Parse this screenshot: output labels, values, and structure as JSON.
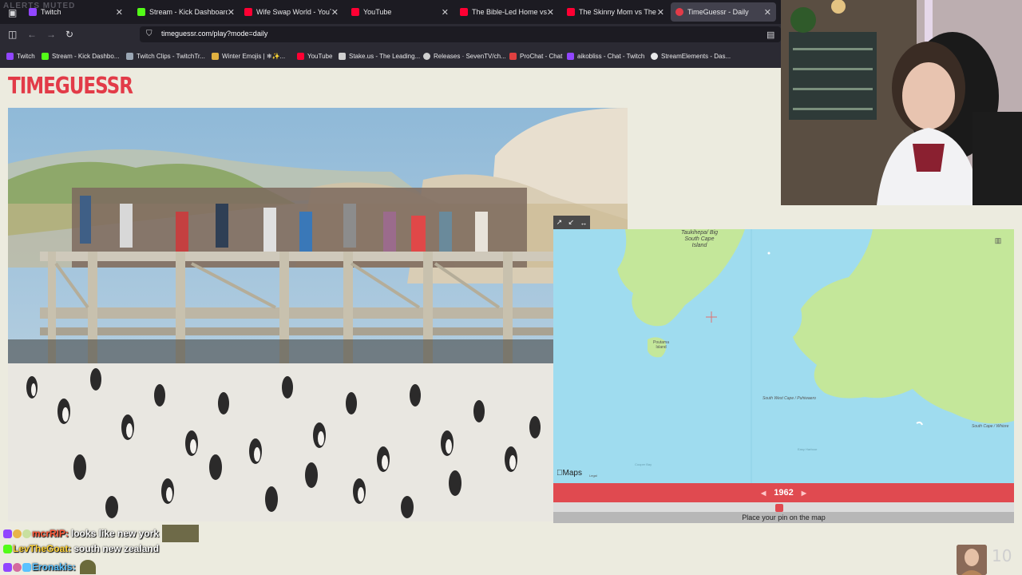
{
  "browser": {
    "alerts_label": "ALERTS MUTED",
    "tabs": [
      {
        "label": "Twitch",
        "color": "#9146ff"
      },
      {
        "label": "Stream - Kick Dashboard",
        "color": "#53fc18"
      },
      {
        "label": "Wife Swap World - YouTube",
        "color": "#ff0033"
      },
      {
        "label": "YouTube",
        "color": "#ff0033"
      },
      {
        "label": "The Bible-Led Home vs. The",
        "color": "#ff0033"
      },
      {
        "label": "The Skinny Mom vs The He",
        "color": "#ff0033"
      },
      {
        "label": "TimeGuessr - Daily",
        "color": "#e23b48"
      }
    ],
    "url": "timeguessr.com/play?mode=daily",
    "bookmarks": [
      {
        "label": "Twitch",
        "color": "#9146ff"
      },
      {
        "label": "Stream - Kick Dashbo...",
        "color": "#53fc18"
      },
      {
        "label": "Twitch Clips - TwitchTr...",
        "color": "#9aa6b4"
      },
      {
        "label": "Winter Emojis | ❄✨...",
        "color": "#e0b040"
      },
      {
        "label": "YouTube",
        "color": "#ff0033"
      },
      {
        "label": "Stake.us - The Leading...",
        "color": "#cfcfcf"
      },
      {
        "label": "Releases · SevenTV/ch...",
        "color": "#cfcfcf"
      },
      {
        "label": "ProChat - Chat",
        "color": "#e04040"
      },
      {
        "label": "aikobliss - Chat - Twitch",
        "color": "#9146ff"
      },
      {
        "label": "StreamElements - Das...",
        "color": "#e8e8ea"
      }
    ]
  },
  "game": {
    "logo": "TIMEGUESSR",
    "map": {
      "labels": {
        "island1": "Taukihepa/ Big South Cape Island",
        "island2": "Poutama Island",
        "cape1": "South West Cape / Puhiwaero",
        "cape2": "South Cape / Whiore",
        "bay1": "Cooper Bay",
        "bay2": "Easy Harbour",
        "maps_logo": "Maps",
        "legal": "Legal"
      },
      "controls": [
        "↗",
        "↙",
        "↔"
      ]
    },
    "year": "1962",
    "year_fraction": 0.49,
    "prev_arrow": "◀",
    "next_arrow": "▶",
    "place_pin_label": "Place your pin on the map",
    "accent_color": "#e04a50"
  },
  "chat": [
    {
      "user": "mcrRIP:",
      "message": "looks like new york",
      "user_color": "#ff5a3a"
    },
    {
      "user": "LevTheGoat:",
      "message": "south new zealand",
      "user_color": "#ffd43a"
    },
    {
      "user": "Eronakis:",
      "message": "",
      "user_color": "#59c2ff"
    }
  ],
  "overlay": {
    "score": "10"
  }
}
